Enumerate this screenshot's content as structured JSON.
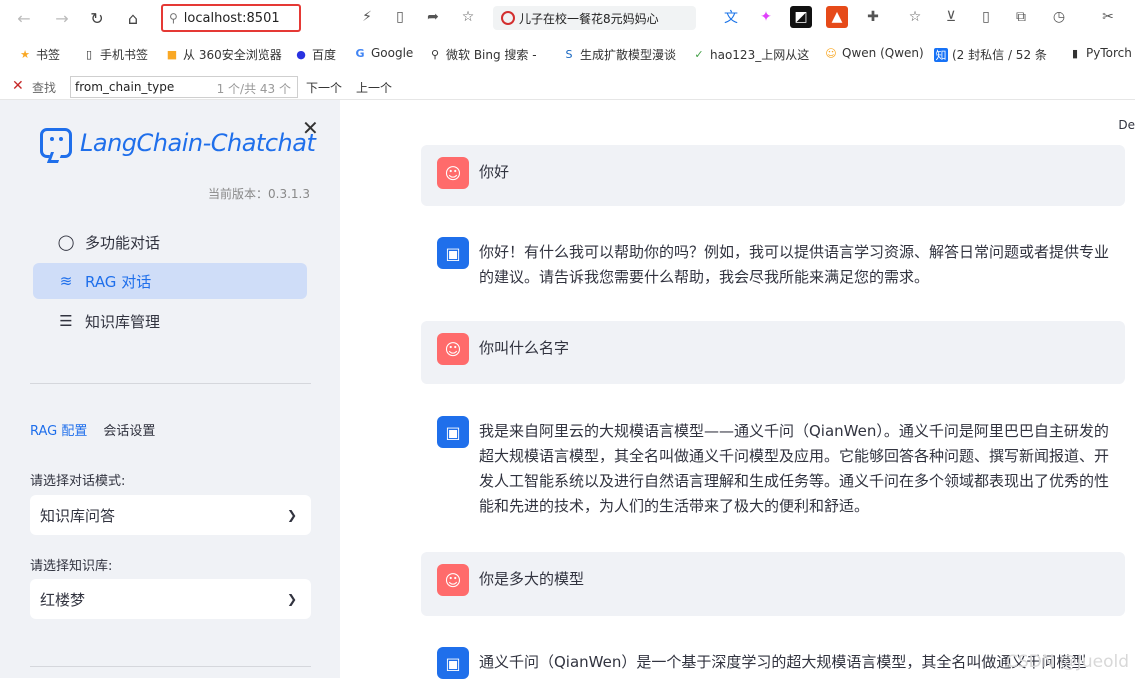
{
  "browser": {
    "address": "localhost:8501",
    "news": "儿子在校一餐花8元妈妈心",
    "bookmarks": [
      "书签",
      "手机书签",
      "从 360安全浏览器",
      "百度",
      "Google",
      "微软 Bing 搜索 -",
      "生成扩散模型漫谈",
      "hao123_上网从这",
      "Qwen (Qwen)",
      "(2 封私信 / 52 条",
      "PyTorch"
    ],
    "find": {
      "label": "查找",
      "value": "from_chain_type",
      "count": "1 个/共 43 个",
      "next": "下一个",
      "prev": "上一个"
    }
  },
  "sidebar": {
    "app_name": "LangChain-Chatchat",
    "version": "当前版本：0.3.1.3",
    "menu": [
      "多功能对话",
      "RAG 对话",
      "知识库管理"
    ],
    "tabs": [
      "RAG 配置",
      "会话设置"
    ],
    "mode_label": "请选择对话模式:",
    "mode_value": "知识库问答",
    "kb_label": "请选择知识库:",
    "kb_value": "红楼梦"
  },
  "main": {
    "deploy": "De",
    "messages": [
      {
        "role": "user",
        "text": "你好"
      },
      {
        "role": "assistant",
        "text": "你好！有什么我可以帮助你的吗？例如，我可以提供语言学习资源、解答日常问题或者提供专业的建议。请告诉我您需要什么帮助，我会尽我所能来满足您的需求。"
      },
      {
        "role": "user",
        "text": "你叫什么名字"
      },
      {
        "role": "assistant",
        "text": "我是来自阿里云的大规模语言模型——通义千问（QianWen）。通义千问是阿里巴巴自主研发的超大规模语言模型，其全名叫做通义千问模型及应用。它能够回答各种问题、撰写新闻报道、开发人工智能系统以及进行自然语言理解和生成任务等。通义千问在多个领域都表现出了优秀的性能和先进的技术，为人们的生活带来了极大的便利和舒适。"
      },
      {
        "role": "user",
        "text": "你是多大的模型"
      },
      {
        "role": "assistant",
        "text": "通义千问（QianWen）是一个基于深度学习的超大规模语言模型，其全名叫做通义千问模型"
      }
    ],
    "watermark": "CSDN @Jueold"
  },
  "colors": {
    "accent": "#1f6feb",
    "user_avatar": "#ff6b6b",
    "sidebar_bg": "#f0f2f6",
    "highlight": "#e53935"
  }
}
